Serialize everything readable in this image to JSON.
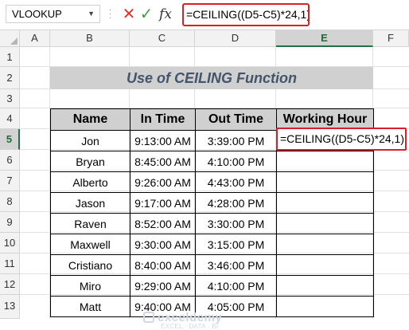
{
  "formula_bar": {
    "name_box": "VLOOKUP",
    "cancel_icon": "✕",
    "enter_icon": "✓",
    "fx_label": "fx",
    "formula": "=CEILING((D5-C5)*24,1)"
  },
  "columns": [
    "A",
    "B",
    "C",
    "D",
    "E",
    "F"
  ],
  "rows": [
    "1",
    "2",
    "3",
    "4",
    "5",
    "6",
    "7",
    "8",
    "9",
    "10",
    "11",
    "12",
    "13"
  ],
  "sheet": {
    "title": "Use of CEILING Function",
    "headers": [
      "Name",
      "In Time",
      "Out Time",
      "Working Hour"
    ],
    "data": [
      [
        "Jon",
        "9:13:00 AM",
        "3:39:00 PM",
        ""
      ],
      [
        "Bryan",
        "8:45:00 AM",
        "4:10:00 PM",
        ""
      ],
      [
        "Alberto",
        "9:26:00 AM",
        "4:43:00 PM",
        ""
      ],
      [
        "Jason",
        "9:17:00 AM",
        "4:28:00 PM",
        ""
      ],
      [
        "Raven",
        "8:52:00 AM",
        "3:30:00 PM",
        ""
      ],
      [
        "Maxwell",
        "9:30:00 AM",
        "3:15:00 PM",
        ""
      ],
      [
        "Cristiano",
        "8:40:00 AM",
        "3:46:00 PM",
        ""
      ],
      [
        "Miro",
        "9:29:00 AM",
        "4:10:00 PM",
        ""
      ],
      [
        "Matt",
        "9:40:00 AM",
        "4:05:00 PM",
        ""
      ]
    ],
    "editing_cell_text": "=CEILING((D5-C5)*24,1)"
  },
  "watermark": {
    "brand": "exceldemy",
    "tagline": "EXCEL · DATA · BI"
  },
  "colors": {
    "accent_red": "#d9202a",
    "excel_green": "#217346",
    "header_fill": "#d0d0d0"
  }
}
